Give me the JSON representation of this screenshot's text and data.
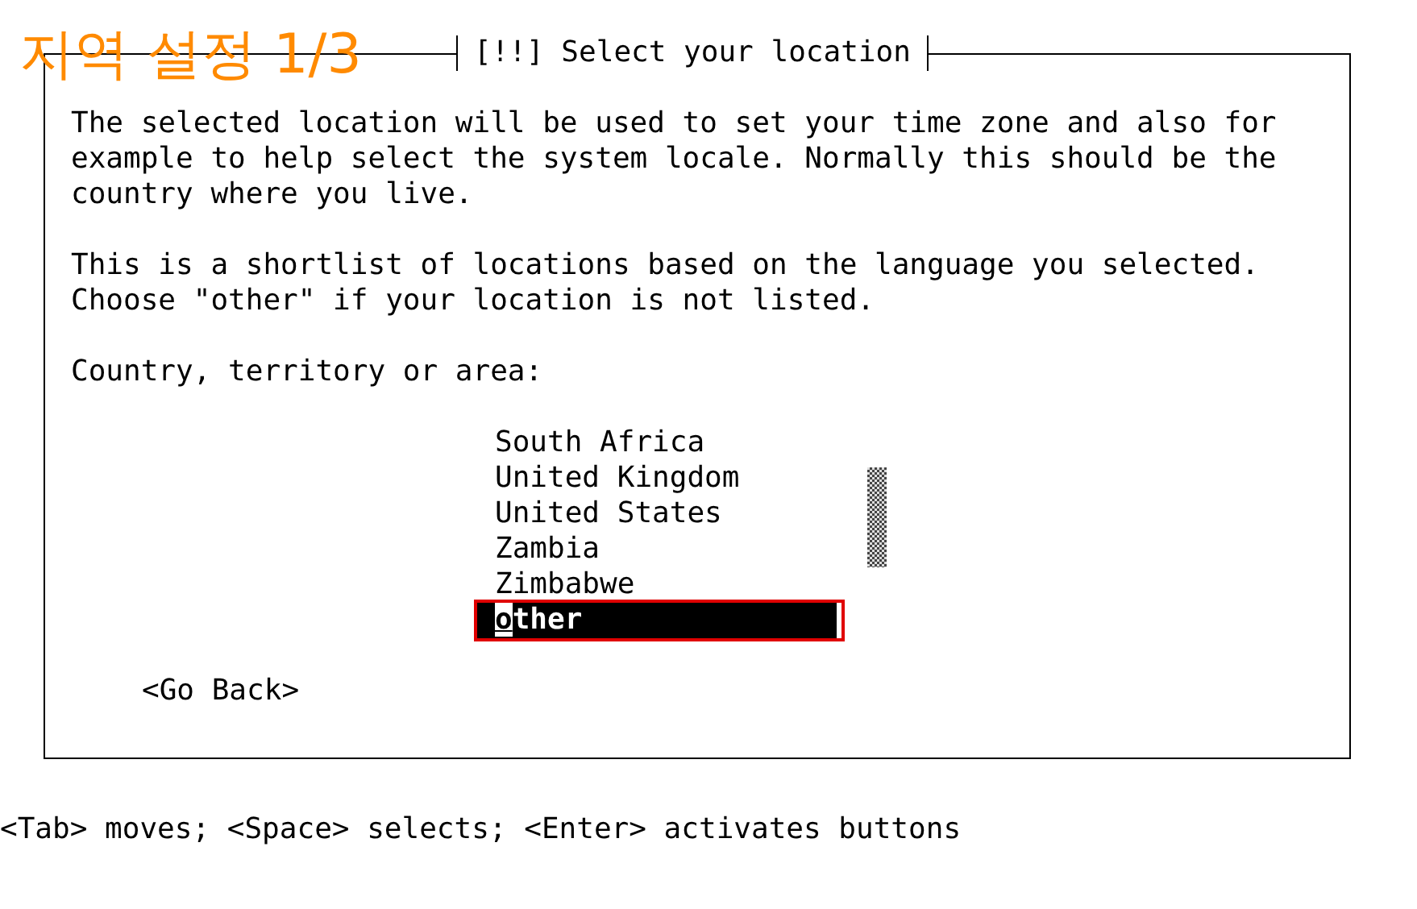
{
  "overlay_label": "지역 설정 1/3",
  "dialog": {
    "title": "[!!] Select your location",
    "paragraphs": [
      [
        "The selected location will be used to set your time zone and also for",
        "example to help select the system locale. Normally this should be the",
        "country where you live."
      ],
      [
        "This is a shortlist of locations based on the language you selected.",
        "Choose \"other\" if your location is not listed."
      ],
      [
        "Country, territory or area:"
      ]
    ],
    "locations": [
      {
        "label": "South Africa",
        "selected": false
      },
      {
        "label": "United Kingdom",
        "selected": false
      },
      {
        "label": "United States",
        "selected": false
      },
      {
        "label": "Zambia",
        "selected": false
      },
      {
        "label": "Zimbabwe",
        "selected": false
      },
      {
        "label": "other",
        "selected": true
      }
    ],
    "back_button": "<Go Back>"
  },
  "status_hint": "<Tab> moves; <Space> selects; <Enter> activates buttons"
}
